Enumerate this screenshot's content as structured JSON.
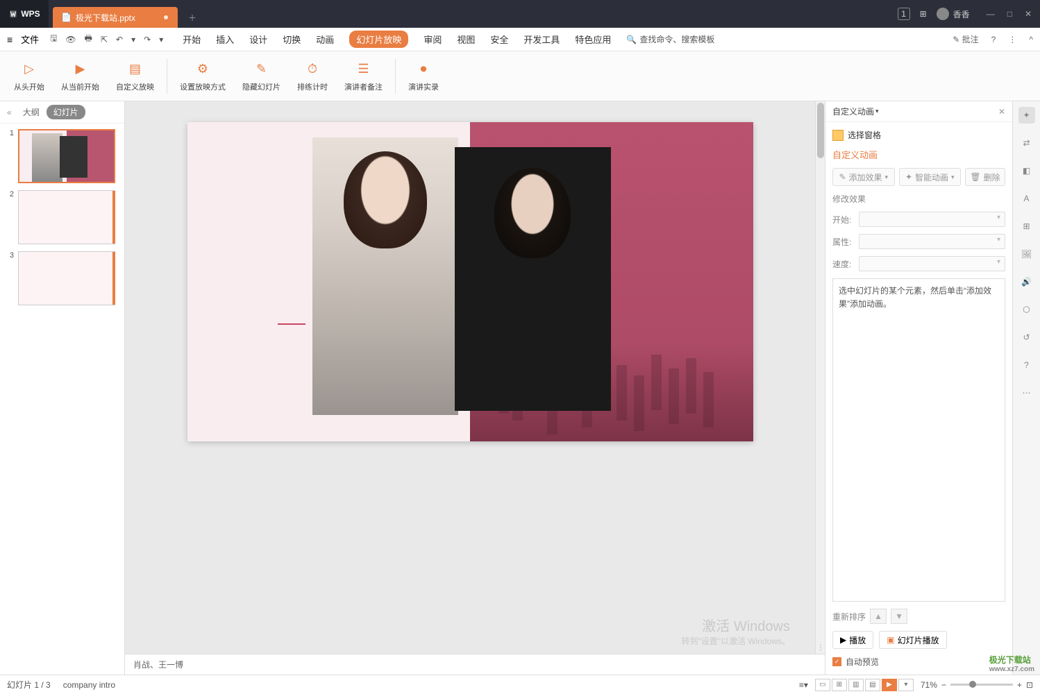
{
  "titlebar": {
    "app": "WPS",
    "tab": "极光下载站.pptx",
    "badge": "1",
    "user": "香香"
  },
  "menubar": {
    "file": "文件",
    "menus": [
      "开始",
      "插入",
      "设计",
      "切换",
      "动画",
      "幻灯片放映",
      "审阅",
      "视图",
      "安全",
      "开发工具",
      "特色应用"
    ],
    "active_index": 5,
    "search": "查找命令、搜索模板",
    "comment": "批注"
  },
  "ribbon": [
    {
      "icon": "▷",
      "label": "从头开始"
    },
    {
      "icon": "▶",
      "label": "从当前开始"
    },
    {
      "icon": "▤",
      "label": "自定义放映"
    },
    {
      "sep": true
    },
    {
      "icon": "⚙",
      "label": "设置放映方式"
    },
    {
      "icon": "✎",
      "label": "隐藏幻灯片"
    },
    {
      "icon": "⏱",
      "label": "排练计时"
    },
    {
      "icon": "☰",
      "label": "演讲者备注"
    },
    {
      "sep": true
    },
    {
      "icon": "⏺",
      "label": "演讲实录"
    }
  ],
  "slides_panel": {
    "tab_outline": "大纲",
    "tab_slides": "幻灯片",
    "slides": [
      1,
      2,
      3
    ]
  },
  "notes": "肖战、王一博",
  "right_panel": {
    "title": "自定义动画",
    "select_pane": "选择窗格",
    "custom_anim": "自定义动画",
    "add_effect": "添加效果",
    "smart_anim": "智能动画",
    "delete": "删除",
    "modify": "修改效果",
    "start": "开始:",
    "property": "属性:",
    "speed": "速度:",
    "hint": "选中幻灯片的某个元素，然后单击“添加效果”添加动画。",
    "reorder": "重新排序",
    "play": "播放",
    "slideshow": "幻灯片播放",
    "autopreview": "自动预览"
  },
  "statusbar": {
    "slide": "幻灯片 1 / 3",
    "section": "company intro",
    "zoom": "71%"
  },
  "watermark": {
    "l1": "激活 Windows",
    "l2": "转到\"设置\"以激活 Windows。",
    "brand": "极光下载站",
    "url": "www.xz7.com"
  }
}
